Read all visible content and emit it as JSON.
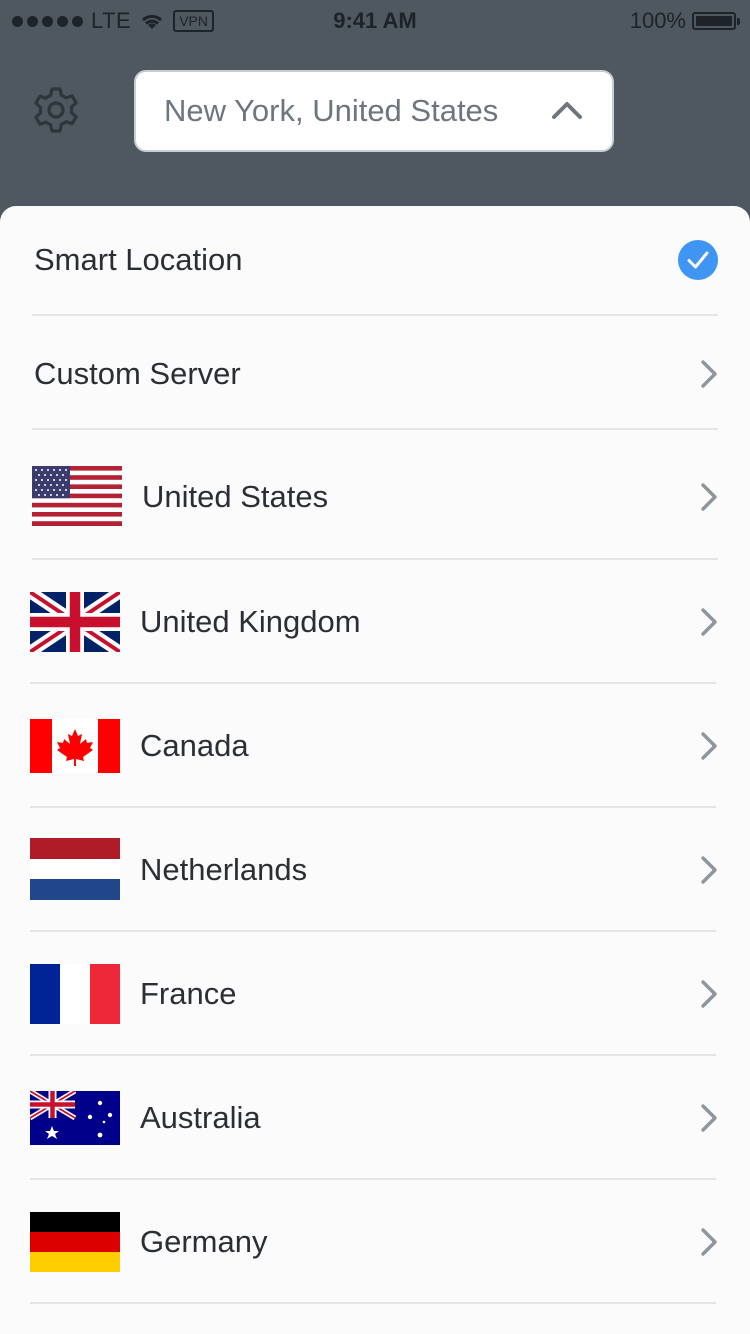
{
  "status_bar": {
    "carrier": "LTE",
    "vpn": "VPN",
    "time": "9:41 AM",
    "battery": "100%"
  },
  "header": {
    "settings_icon": "gear-icon",
    "location_selected": "New York, United States",
    "dropdown_icon": "chevron-up-icon"
  },
  "menu": {
    "smart_location": "Smart Location",
    "custom_server": "Custom Server"
  },
  "countries": [
    {
      "name": "United States",
      "flag": "us-flag-icon"
    },
    {
      "name": "United Kingdom",
      "flag": "uk-flag-icon"
    },
    {
      "name": "Canada",
      "flag": "canada-flag-icon"
    },
    {
      "name": "Netherlands",
      "flag": "netherlands-flag-icon"
    },
    {
      "name": "France",
      "flag": "france-flag-icon"
    },
    {
      "name": "Australia",
      "flag": "australia-flag-icon"
    },
    {
      "name": "Germany",
      "flag": "germany-flag-icon"
    }
  ],
  "colors": {
    "header_bg": "#4f5760",
    "check_blue": "#3f95f2",
    "chevron": "#8d949c"
  }
}
